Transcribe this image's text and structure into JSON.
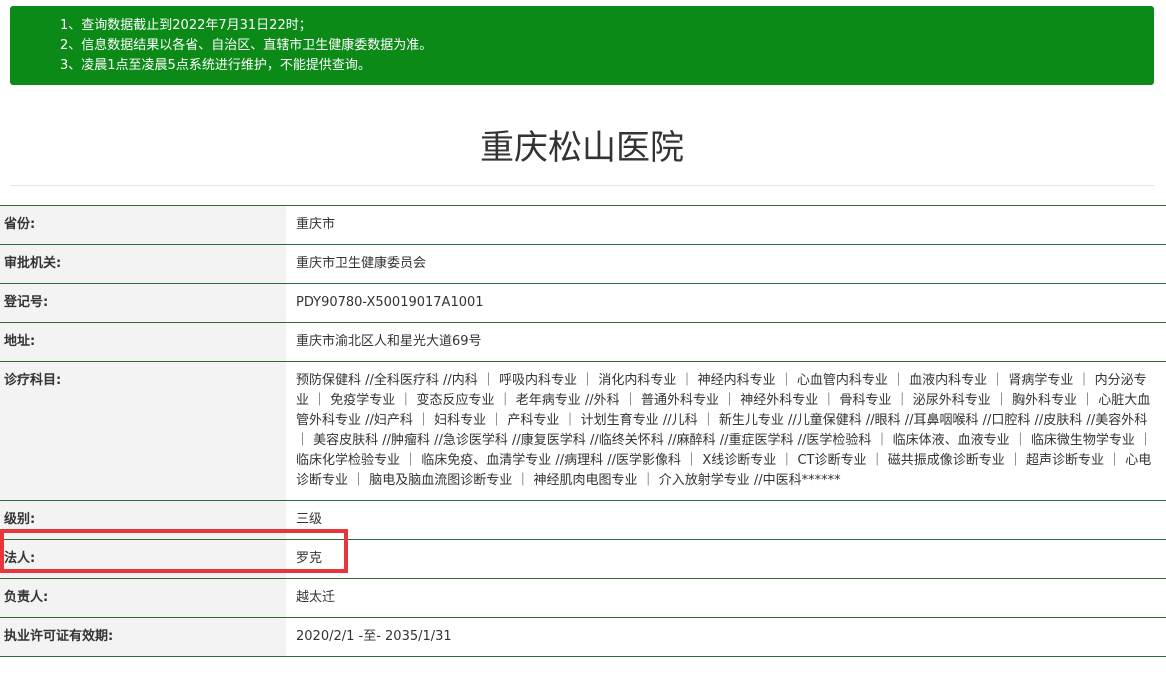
{
  "notice": {
    "lines": [
      "1、查询数据截止到2022年7月31日22时；",
      "2、信息数据结果以各省、自治区、直辖市卫生健康委数据为准。",
      "3、凌晨1点至凌晨5点系统进行维护，不能提供查询。"
    ]
  },
  "hospital": {
    "name": "重庆松山医院"
  },
  "rows": [
    {
      "label": "省份:",
      "value": "重庆市"
    },
    {
      "label": "审批机关:",
      "value": "重庆市卫生健康委员会"
    },
    {
      "label": "登记号:",
      "value": "PDY90780-X50019017A1001"
    },
    {
      "label": "地址:",
      "value": "重庆市渝北区人和星光大道69号"
    },
    {
      "label": "诊疗科目:",
      "value": "预防保健科 //全科医疗科 //内科 ｜ 呼吸内科专业 ｜ 消化内科专业 ｜ 神经内科专业 ｜ 心血管内科专业 ｜ 血液内科专业 ｜ 肾病学专业 ｜ 内分泌专业 ｜ 免疫学专业 ｜ 变态反应专业 ｜ 老年病专业 //外科 ｜ 普通外科专业 ｜ 神经外科专业 ｜ 骨科专业 ｜ 泌尿外科专业 ｜ 胸外科专业 ｜ 心脏大血管外科专业 //妇产科 ｜ 妇科专业 ｜ 产科专业 ｜ 计划生育专业 //儿科 ｜ 新生儿专业 //儿童保健科 //眼科 //耳鼻咽喉科 //口腔科 //皮肤科 //美容外科 ｜ 美容皮肤科 //肿瘤科 //急诊医学科 //康复医学科 //临终关怀科 //麻醉科 //重症医学科 //医学检验科 ｜ 临床体液、血液专业 ｜ 临床微生物学专业 ｜ 临床化学检验专业 ｜ 临床免疫、血清学专业 //病理科 //医学影像科 ｜ X线诊断专业 ｜ CT诊断专业 ｜ 磁共振成像诊断专业 ｜ 超声诊断专业 ｜ 心电诊断专业 ｜ 脑电及脑血流图诊断专业 ｜ 神经肌肉电图专业 ｜ 介入放射学专业 //中医科******"
    },
    {
      "label": "级别:",
      "value": "三级"
    },
    {
      "label": "法人:",
      "value": "罗克"
    },
    {
      "label": "负责人:",
      "value": "越太迁"
    },
    {
      "label": "执业许可证有效期:",
      "value": "2020/2/1 -至- 2035/1/31"
    }
  ],
  "colors": {
    "notice_bg": "#0b8a18",
    "row_border": "#2e6b3a",
    "highlight": "#e8373c"
  }
}
